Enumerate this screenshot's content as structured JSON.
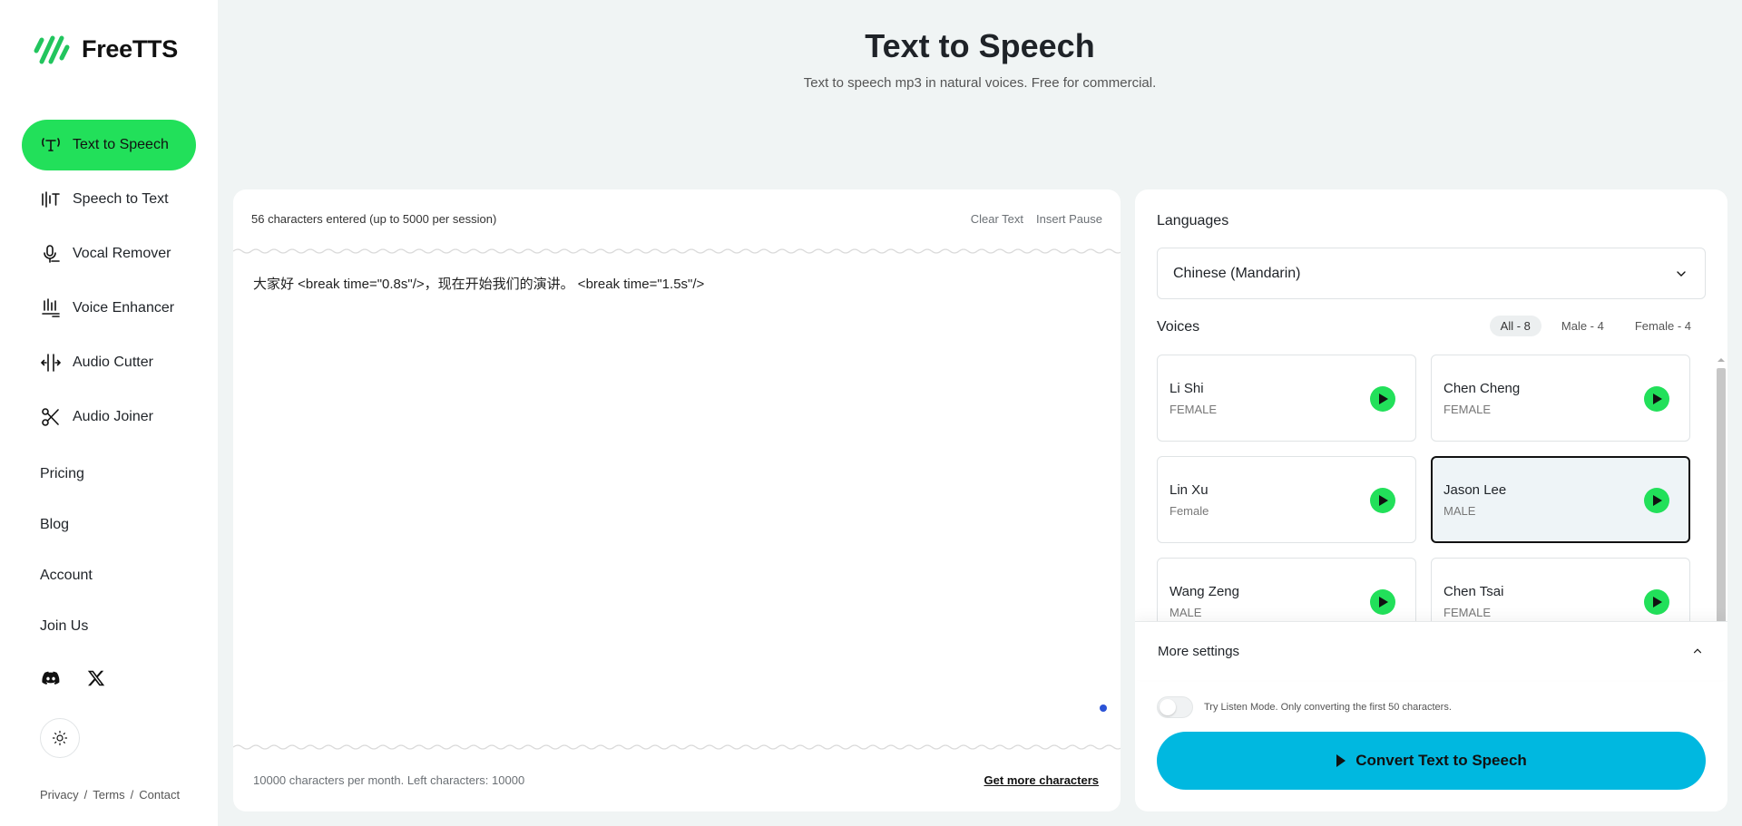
{
  "app": {
    "name": "FreeTTS"
  },
  "sidebar": {
    "nav": [
      {
        "label": "Text to Speech",
        "icon": "text-t-icon",
        "active": true
      },
      {
        "label": "Speech to Text",
        "icon": "waveform-text-icon"
      },
      {
        "label": "Vocal Remover",
        "icon": "microphone-icon"
      },
      {
        "label": "Voice Enhancer",
        "icon": "sound-enhance-icon"
      },
      {
        "label": "Audio Cutter",
        "icon": "audio-cut-icon"
      },
      {
        "label": "Audio Joiner",
        "icon": "scissors-icon"
      }
    ],
    "links": [
      "Pricing",
      "Blog",
      "Account",
      "Join Us"
    ],
    "social": [
      "discord-icon",
      "x-icon"
    ],
    "theme_icon": "sun-icon",
    "footer": {
      "privacy": "Privacy",
      "terms": "Terms",
      "contact": "Contact",
      "sep": "/"
    }
  },
  "header": {
    "title": "Text to Speech",
    "subtitle": "Text to speech mp3 in natural voices. Free for commercial."
  },
  "editor": {
    "char_count": "56 characters entered (up to 5000 per session)",
    "clear_text": "Clear Text",
    "insert_pause": "Insert Pause",
    "text": "大家好 <break time=\"0.8s\"/>，现在开始我们的演讲。 <break time=\"1.5s\"/>",
    "quota": "10000 characters per month. Left characters: 10000",
    "get_more": "Get more characters"
  },
  "panel": {
    "languages_label": "Languages",
    "language": "Chinese (Mandarin)",
    "voices_label": "Voices",
    "filters": {
      "all": "All - 8",
      "male": "Male - 4",
      "female": "Female - 4"
    },
    "voices": [
      {
        "name": "Li Shi",
        "gender": "FEMALE"
      },
      {
        "name": "Chen Cheng",
        "gender": "FEMALE"
      },
      {
        "name": "Lin Xu",
        "gender": "Female"
      },
      {
        "name": "Jason Lee",
        "gender": "MALE",
        "selected": true
      },
      {
        "name": "Wang Zeng",
        "gender": "MALE"
      },
      {
        "name": "Chen Tsai",
        "gender": "FEMALE"
      }
    ],
    "more_settings": "More settings",
    "listen_mode": "Try Listen Mode. Only converting the first 50 characters.",
    "convert": "Convert Text to Speech"
  },
  "colors": {
    "accent_green": "#22e05a",
    "convert_blue": "#00b8e0"
  }
}
